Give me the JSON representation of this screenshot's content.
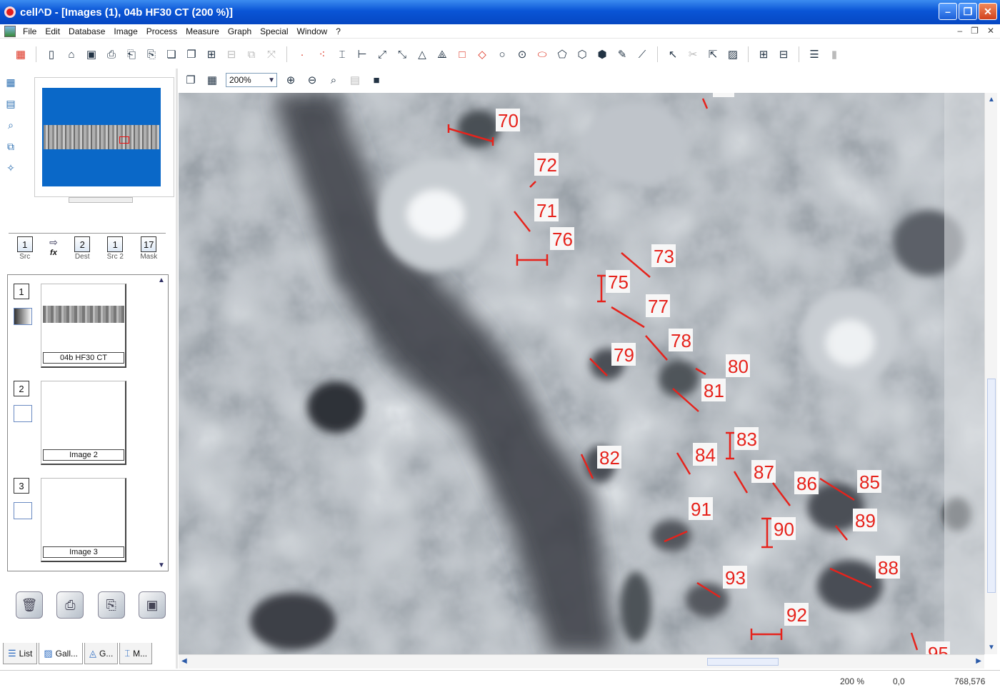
{
  "window": {
    "title": "cell^D - [Images (1), 04b HF30 CT (200 %)]"
  },
  "menu": [
    "File",
    "Edit",
    "Database",
    "Image",
    "Process",
    "Measure",
    "Graph",
    "Special",
    "Window",
    "?"
  ],
  "zoom": {
    "value": "200%"
  },
  "channels": [
    {
      "number": "1",
      "label": "Src"
    },
    {
      "number": "2",
      "label": "Dest"
    },
    {
      "number": "1",
      "label": "Src 2"
    },
    {
      "number": "17",
      "label": "Mask"
    }
  ],
  "channel_fx": "fx",
  "gallery": {
    "items": [
      {
        "number": "1",
        "caption": "04b HF30 CT"
      },
      {
        "number": "2",
        "caption": "Image 2"
      },
      {
        "number": "3",
        "caption": "Image 3"
      }
    ]
  },
  "left_tabs": [
    "List",
    "Gall...",
    "G...",
    "M..."
  ],
  "status": {
    "zoom": "200 %",
    "coords": "0,0",
    "size": "768,576"
  },
  "measurement_labels": [
    "70",
    "72",
    "71",
    "76",
    "73",
    "75",
    "77",
    "78",
    "79",
    "80",
    "81",
    "83",
    "82",
    "84",
    "87",
    "86",
    "85",
    "91",
    "90",
    "89",
    "93",
    "88",
    "92",
    "95"
  ],
  "colors": {
    "title_bar": "#0a55d6",
    "marker": "#e6231c",
    "navigator_bg": "#0a68c8"
  }
}
